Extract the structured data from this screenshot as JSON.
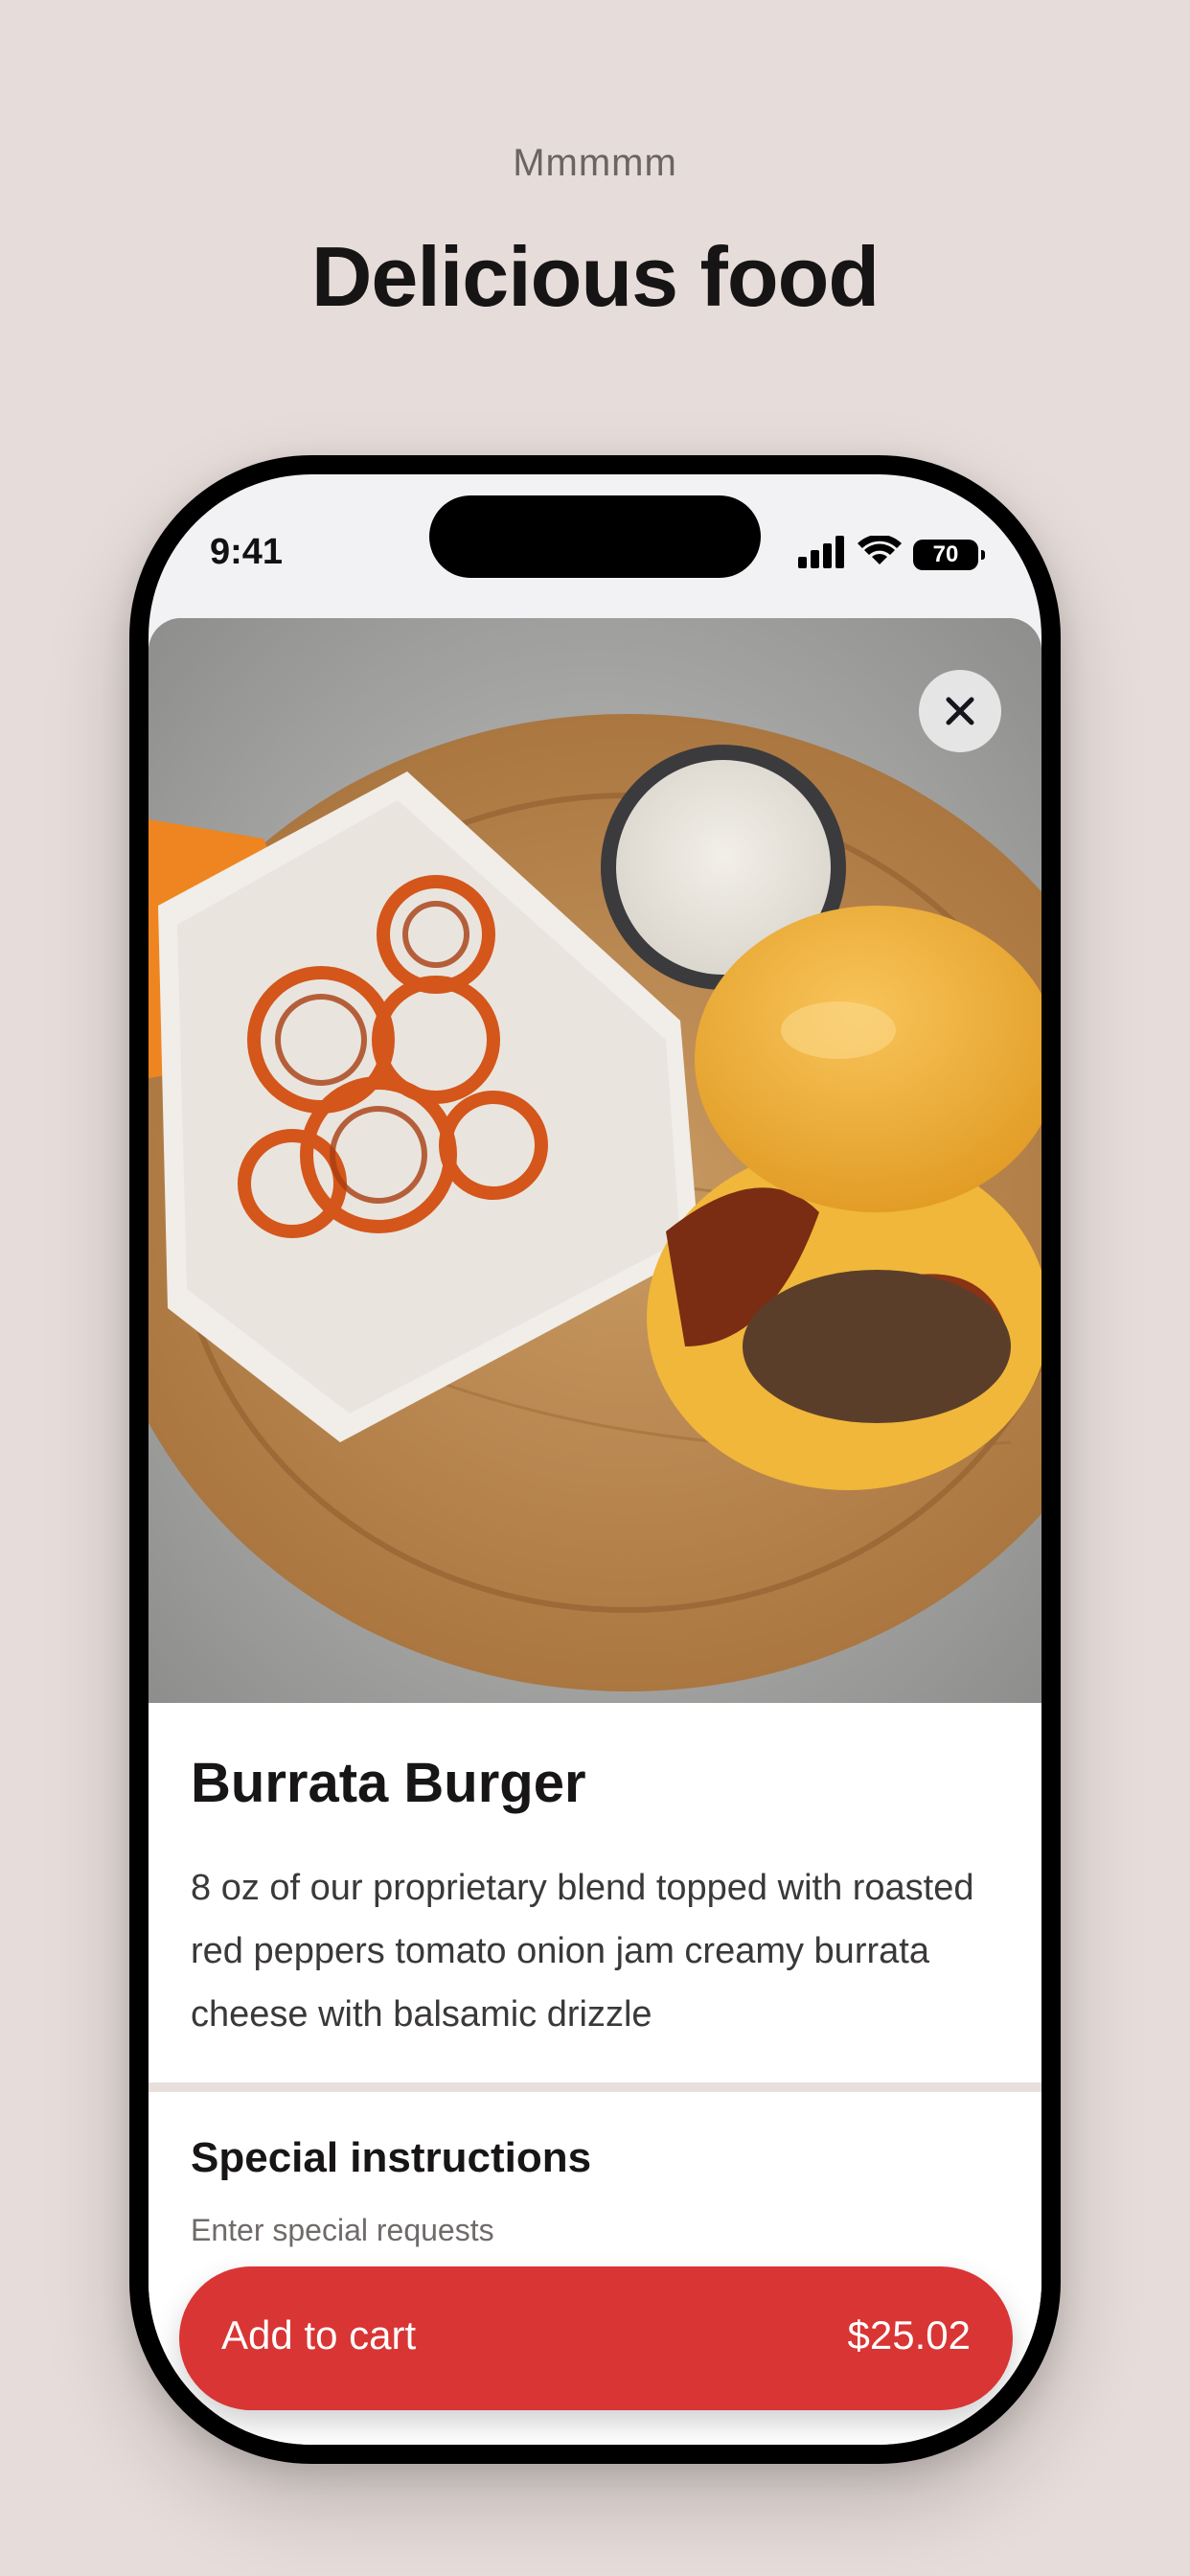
{
  "marketing": {
    "eyebrow": "Mmmmm",
    "headline": "Delicious food"
  },
  "status_bar": {
    "time": "9:41",
    "battery": "70",
    "icons": [
      "signal-icon",
      "wifi-icon",
      "battery-icon"
    ]
  },
  "item": {
    "photo_icon": "food-photo",
    "close_icon": "close-icon",
    "title": "Burrata Burger",
    "description": "8 oz of our proprietary blend topped with roasted red peppers tomato onion jam creamy burrata cheese with balsamic drizzle"
  },
  "special_instructions": {
    "title": "Special instructions",
    "placeholder": "Enter special requests"
  },
  "cart": {
    "label": "Add to cart",
    "price": "$25.02"
  },
  "colors": {
    "background": "#e6dcd9",
    "accent": "#d93535",
    "text": "#171515"
  }
}
